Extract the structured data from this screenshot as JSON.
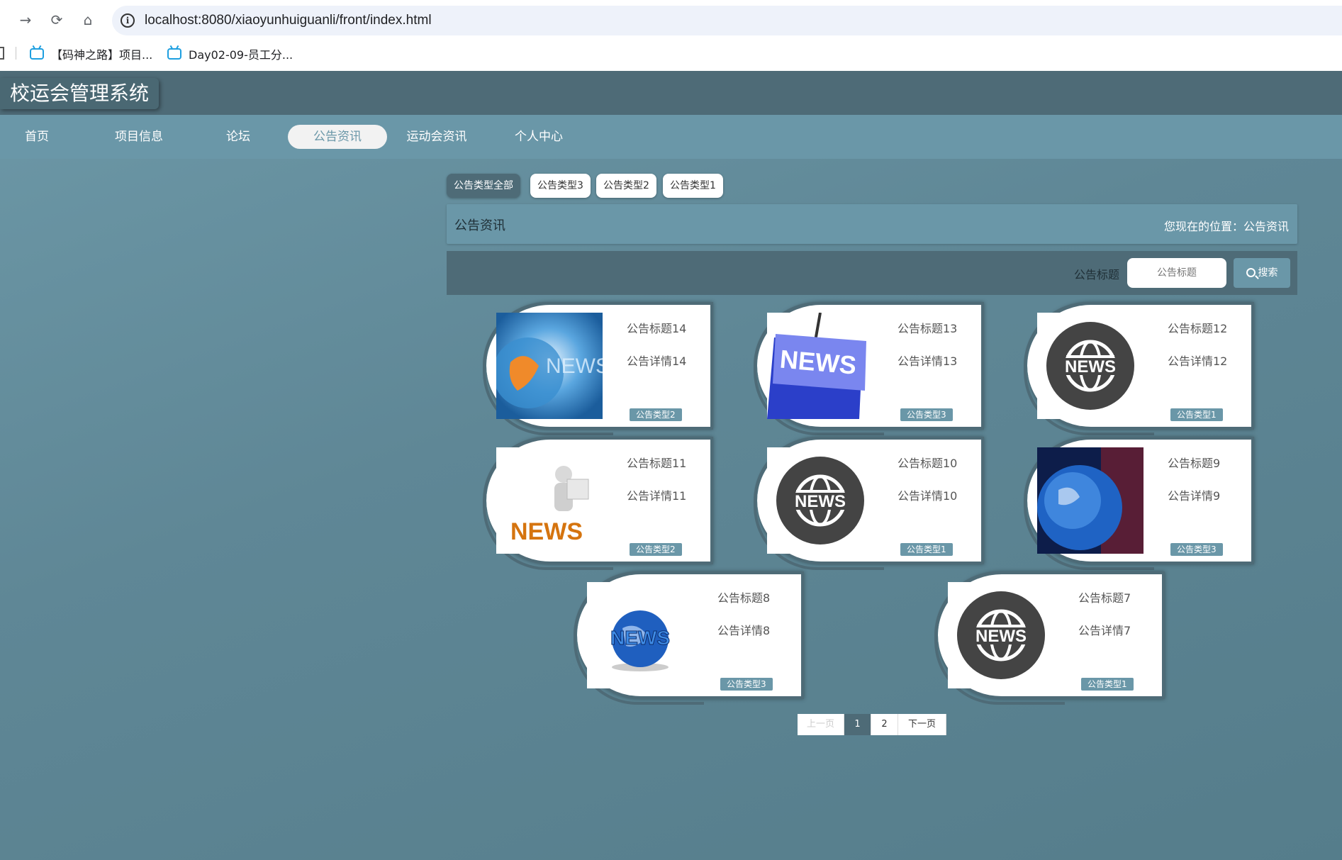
{
  "browser": {
    "url": "localhost:8080/xiaoyunhuiguanli/front/index.html",
    "bookmarks": [
      "【码神之路】项目...",
      "Day02-09-员工分..."
    ]
  },
  "site": {
    "title": "校运会管理系统"
  },
  "menu": [
    {
      "label": "首页",
      "active": false
    },
    {
      "label": "项目信息",
      "active": false
    },
    {
      "label": "论坛",
      "active": false
    },
    {
      "label": "公告资讯",
      "active": true
    },
    {
      "label": "运动会资讯",
      "active": false
    },
    {
      "label": "个人中心",
      "active": false
    }
  ],
  "filters": [
    "公告类型全部",
    "公告类型3",
    "公告类型2",
    "公告类型1"
  ],
  "section": {
    "title": "公告资讯",
    "breadcrumb": "您现在的位置：公告资讯"
  },
  "search": {
    "label": "公告标题",
    "placeholder": "公告标题",
    "button": "搜索"
  },
  "cards": [
    {
      "title": "公告标题14",
      "detail": "公告详情14",
      "type": "公告类型2",
      "image": "news-globe-blue-orange"
    },
    {
      "title": "公告标题13",
      "detail": "公告详情13",
      "type": "公告类型3",
      "image": "news-keyboard-key"
    },
    {
      "title": "公告标题12",
      "detail": "公告详情12",
      "type": "公告类型1",
      "image": "news-round-icon"
    },
    {
      "title": "公告标题11",
      "detail": "公告详情11",
      "type": "公告类型2",
      "image": "news-reader-3d"
    },
    {
      "title": "公告标题10",
      "detail": "公告详情10",
      "type": "公告类型1",
      "image": "news-round-icon"
    },
    {
      "title": "公告标题9",
      "detail": "公告详情9",
      "type": "公告类型3",
      "image": "news-globe-blue"
    },
    {
      "title": "公告标题8",
      "detail": "公告详情8",
      "type": "公告类型3",
      "image": "news-globe-3d"
    },
    {
      "title": "公告标题7",
      "detail": "公告详情7",
      "type": "公告类型1",
      "image": "news-round-icon"
    }
  ],
  "pagination": {
    "prev": "上一页",
    "pages": [
      "1",
      "2"
    ],
    "current": "1",
    "next": "下一页"
  },
  "news_text": "NEWS"
}
